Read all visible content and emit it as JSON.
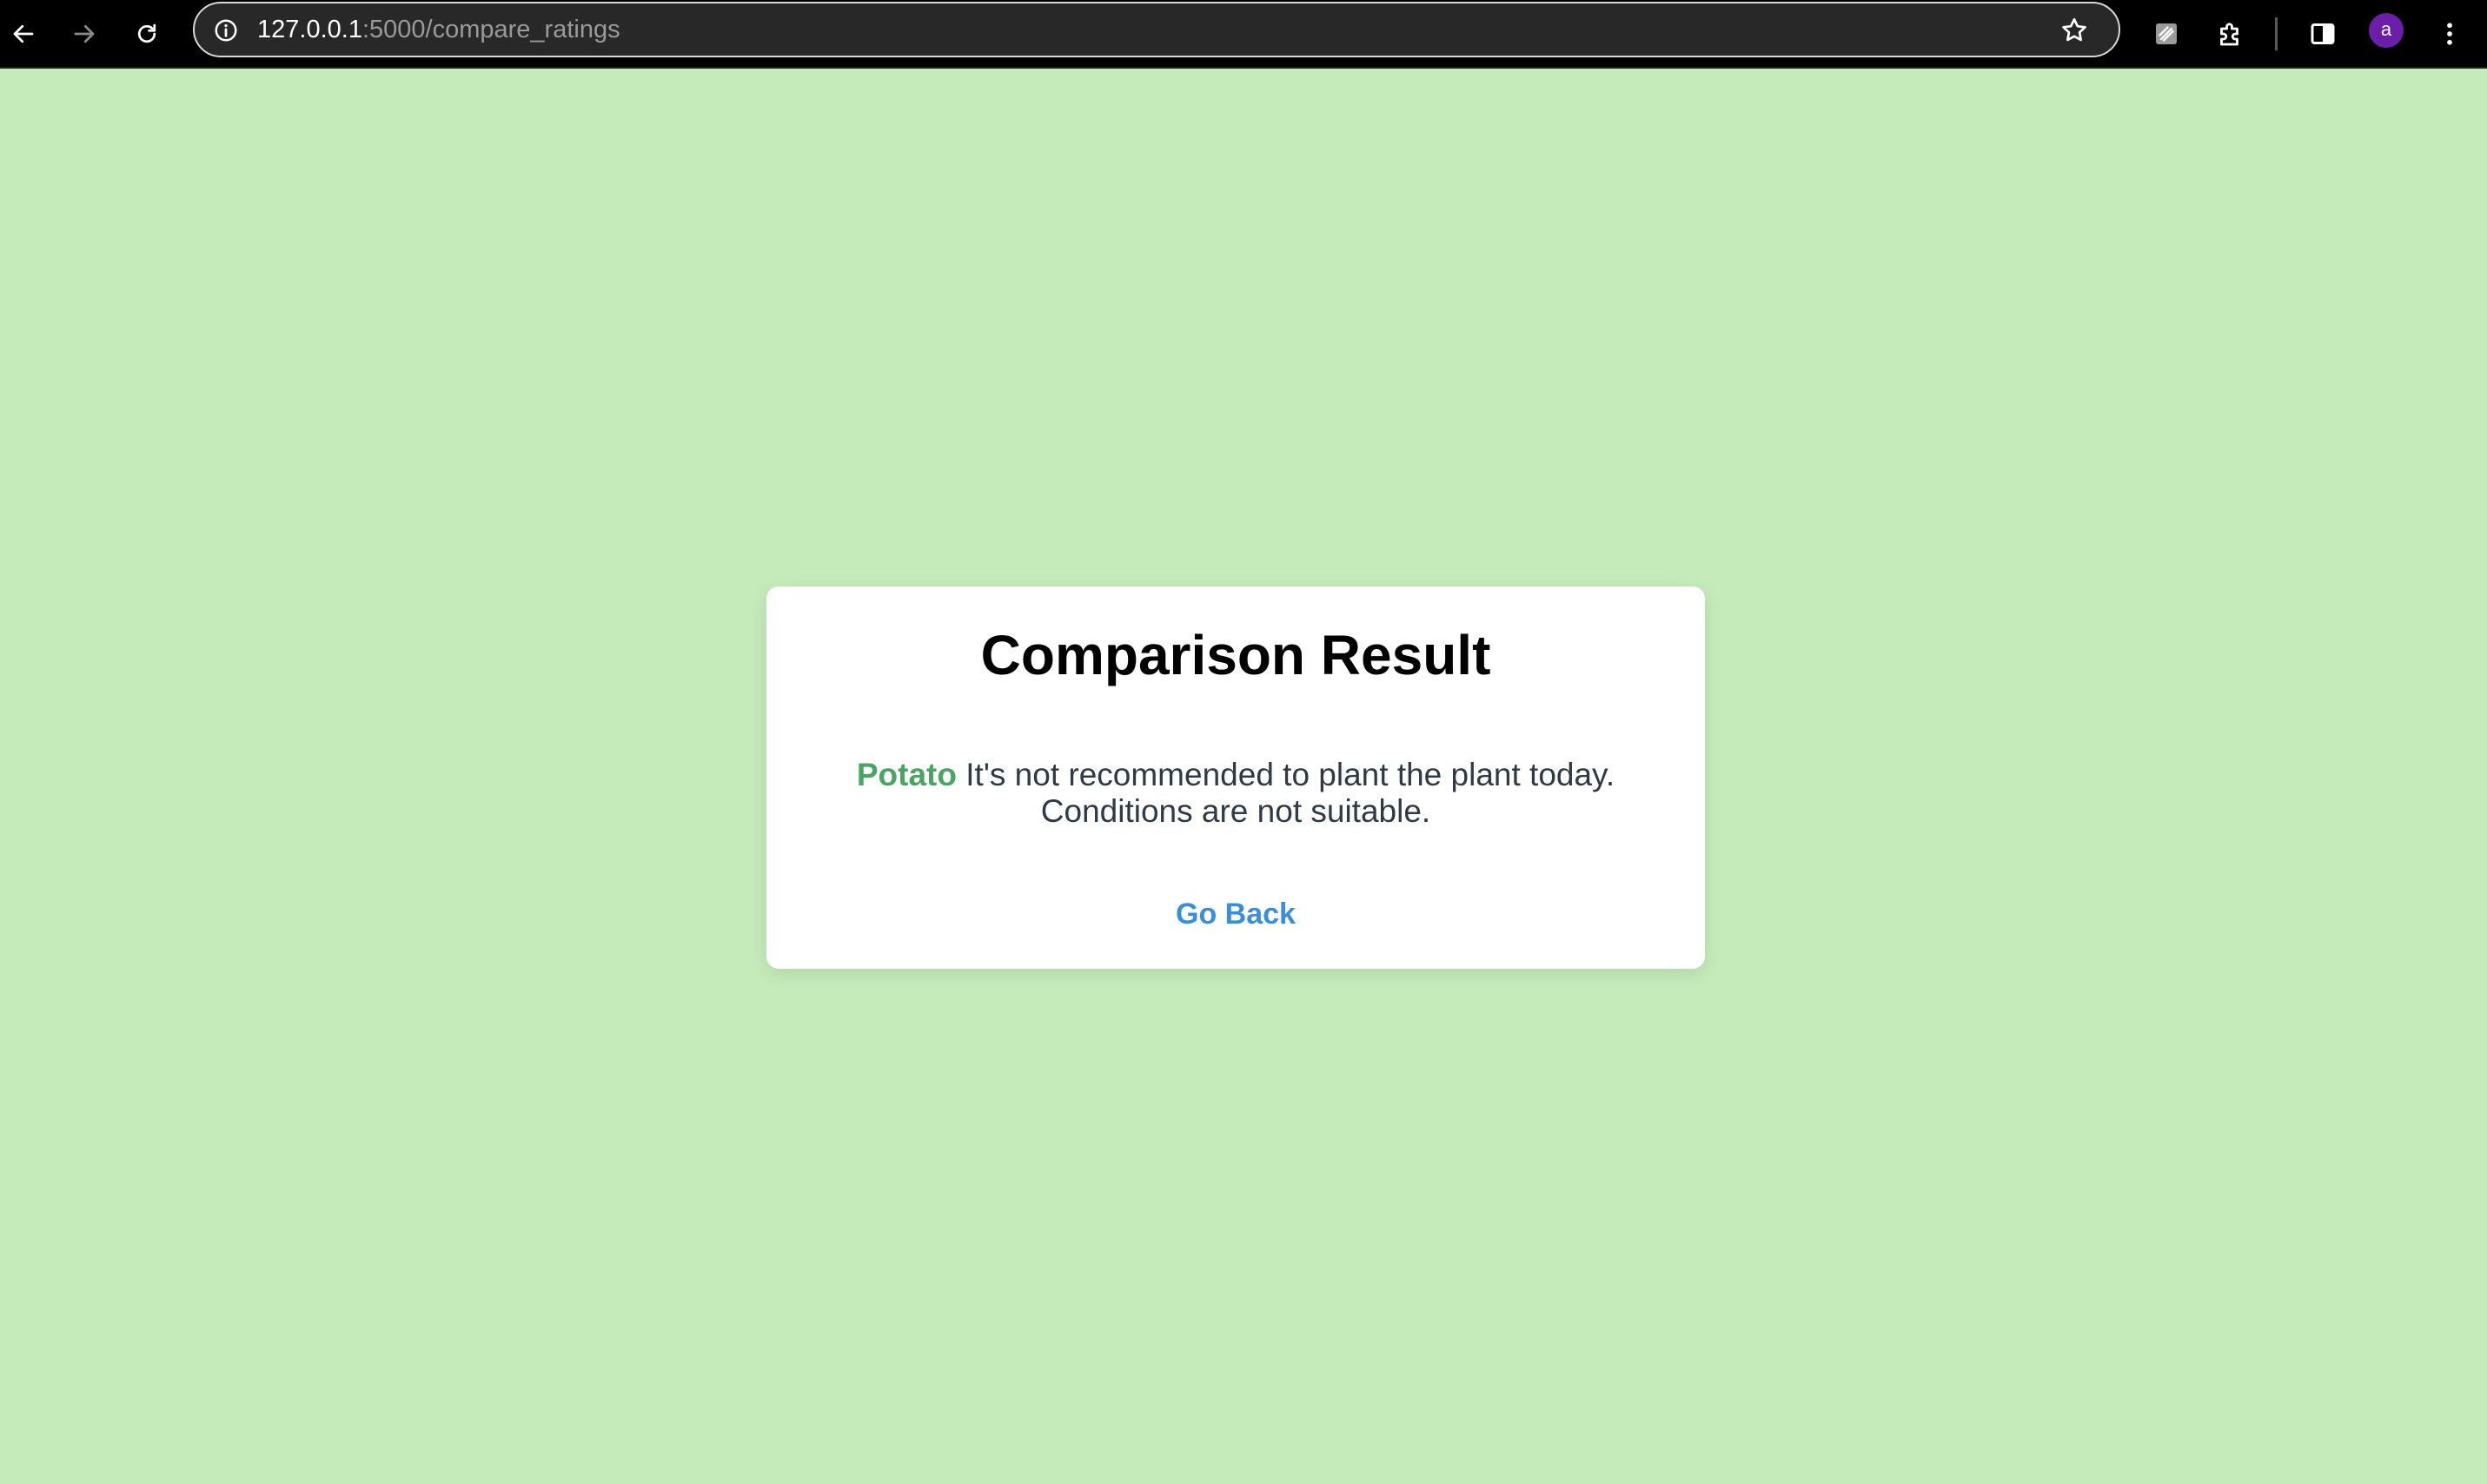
{
  "browser": {
    "url_host": "127.0.0.1",
    "url_rest": ":5000/compare_ratings",
    "profile_initial": "a",
    "icons": {
      "back": "arrow-left-icon",
      "forward": "arrow-right-icon",
      "reload": "reload-icon",
      "site_info": "info-icon",
      "bookmark": "star-icon",
      "extension_1": "extension-icon",
      "extensions": "puzzle-icon",
      "side_panel": "side-panel-icon",
      "menu": "kebab-menu-icon"
    }
  },
  "colors": {
    "page_background": "#c6ebbb",
    "plant_name": "#4aa564",
    "link": "#3b8fd6",
    "avatar": "#6b1fa8"
  },
  "result": {
    "title": "Comparison Result",
    "plant": "Potato",
    "message": "It's not recommended to plant the plant today. Conditions are not suitable.",
    "back_link": "Go Back"
  }
}
